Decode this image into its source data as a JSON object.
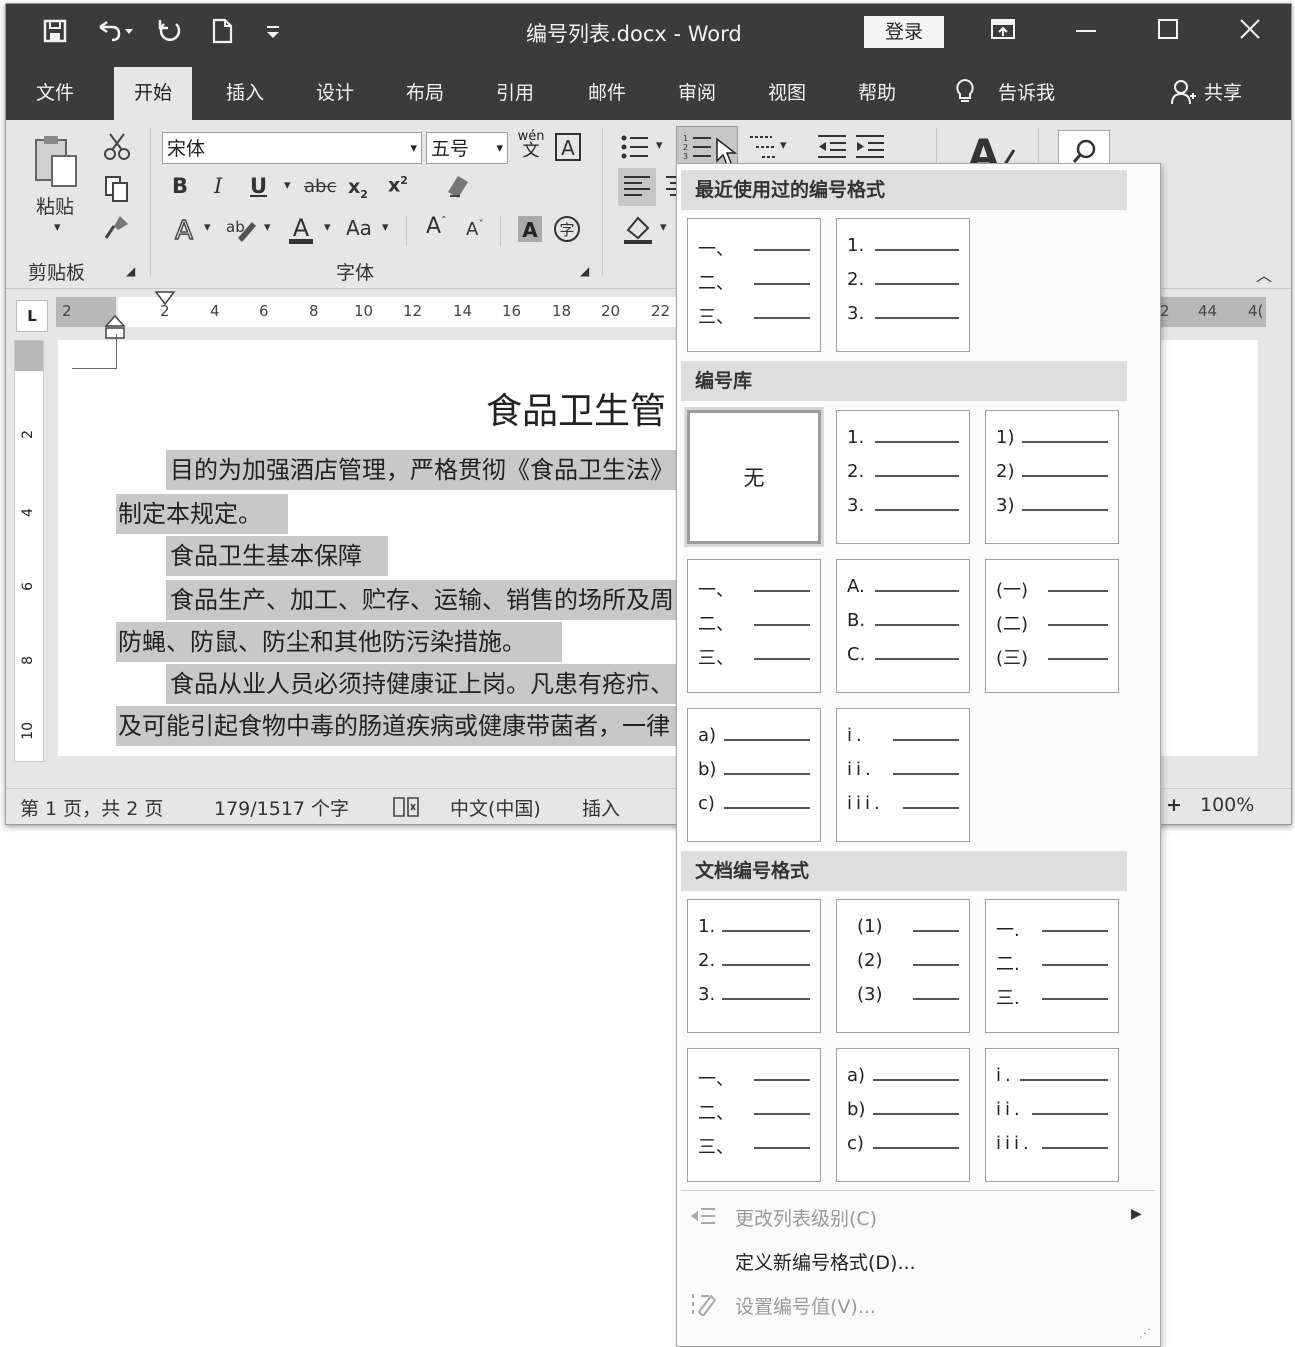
{
  "window": {
    "title": "编号列表.docx  -  Word",
    "login_label": "登录"
  },
  "menu_tabs": [
    "文件",
    "开始",
    "插入",
    "设计",
    "布局",
    "引用",
    "邮件",
    "审阅",
    "视图",
    "帮助"
  ],
  "active_tab": "开始",
  "tell_me": "告诉我",
  "share": "共享",
  "clipboard": {
    "paste_label": "粘贴",
    "group_label": "剪贴板"
  },
  "font": {
    "name": "宋体",
    "size": "五号",
    "group_label": "字体",
    "wen_pinyin": "wén",
    "wen_char": "文",
    "aa_label": "Aa"
  },
  "ruler_numbers": [
    "2",
    "2",
    "4",
    "6",
    "8",
    "10",
    "12",
    "14",
    "16",
    "18",
    "20",
    "22"
  ],
  "ruler_right_numbers": [
    "2",
    "44",
    "4("
  ],
  "vruler_numbers": [
    "2",
    "4",
    "6",
    "8",
    "10"
  ],
  "document": {
    "title": "食品卫生管",
    "lines": [
      "目的为加强酒店管理，严格贯彻《食品卫生法》",
      "制定本规定。",
      "食品卫生基本保障",
      "食品生产、加工、贮存、运输、销售的场所及周",
      "防蝇、防鼠、防尘和其他防污染措施。",
      "食品从业人员必须持健康证上岗。凡患有疮疖、",
      "及可能引起食物中毒的肠道疾病或健康带菌者，一律"
    ]
  },
  "status": {
    "page": "第 1 页，共 2 页",
    "words": "179/1517 个字",
    "language": "中文(中国)",
    "mode": "插入",
    "zoom": "100%"
  },
  "numbering_menu": {
    "section_recent": "最近使用过的编号格式",
    "section_library": "编号库",
    "section_document": "文档编号格式",
    "none_label": "无",
    "recent": [
      [
        "一、",
        "二、",
        "三、"
      ],
      [
        "1.",
        "2.",
        "3."
      ]
    ],
    "library": [
      [
        "1.",
        "2.",
        "3."
      ],
      [
        "1)",
        "2)",
        "3)"
      ],
      [
        "一、",
        "二、",
        "三、"
      ],
      [
        "A.",
        "B.",
        "C."
      ],
      [
        "(一)",
        "(二)",
        "(三)"
      ],
      [
        "a)",
        "b)",
        "c)"
      ],
      [
        "i.",
        "ii.",
        "iii."
      ]
    ],
    "document_formats": [
      [
        "1.",
        "2.",
        "3."
      ],
      [
        "(1)",
        "(2)",
        "(3)"
      ],
      [
        "一.",
        "二.",
        "三."
      ],
      [
        "一、",
        "二、",
        "三、"
      ],
      [
        "a)",
        "b)",
        "c)"
      ],
      [
        "i.",
        "ii.",
        "iii."
      ]
    ],
    "change_level": "更改列表级别(C)",
    "define_new": "定义新编号格式(D)...",
    "set_value": "设置编号值(V)..."
  }
}
